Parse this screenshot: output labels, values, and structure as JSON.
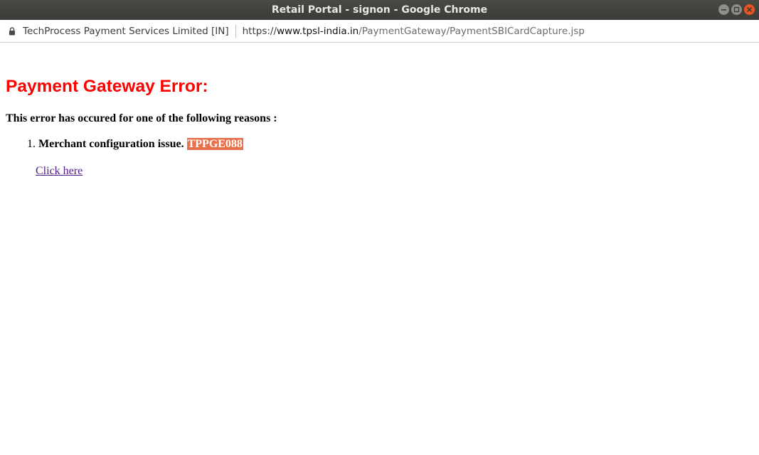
{
  "window": {
    "title": "Retail Portal - signon - Google Chrome",
    "controls": [
      "minimize-icon",
      "maximize-icon",
      "close-icon"
    ]
  },
  "addressbar": {
    "secure_org": "TechProcess Payment Services Limited [IN]",
    "url_scheme": "https://",
    "url_domain": "www.tpsl-india.in",
    "url_path": "/PaymentGateway/PaymentSBICardCapture.jsp",
    "lock_icon": "lock-icon"
  },
  "page": {
    "heading": "Payment Gateway Error:",
    "intro": "This error has occured for one of the following reasons :",
    "reasons": [
      {
        "number": "1.",
        "text": "Merchant configuration issue.",
        "code": "TPPGE088"
      }
    ],
    "link_text": "Click here"
  },
  "colors": {
    "heading": "#ff0000",
    "code_highlight": "#e8704a",
    "link_visited": "#551a8b",
    "titlebar": "#3c3b37",
    "close_button": "#e95420"
  }
}
